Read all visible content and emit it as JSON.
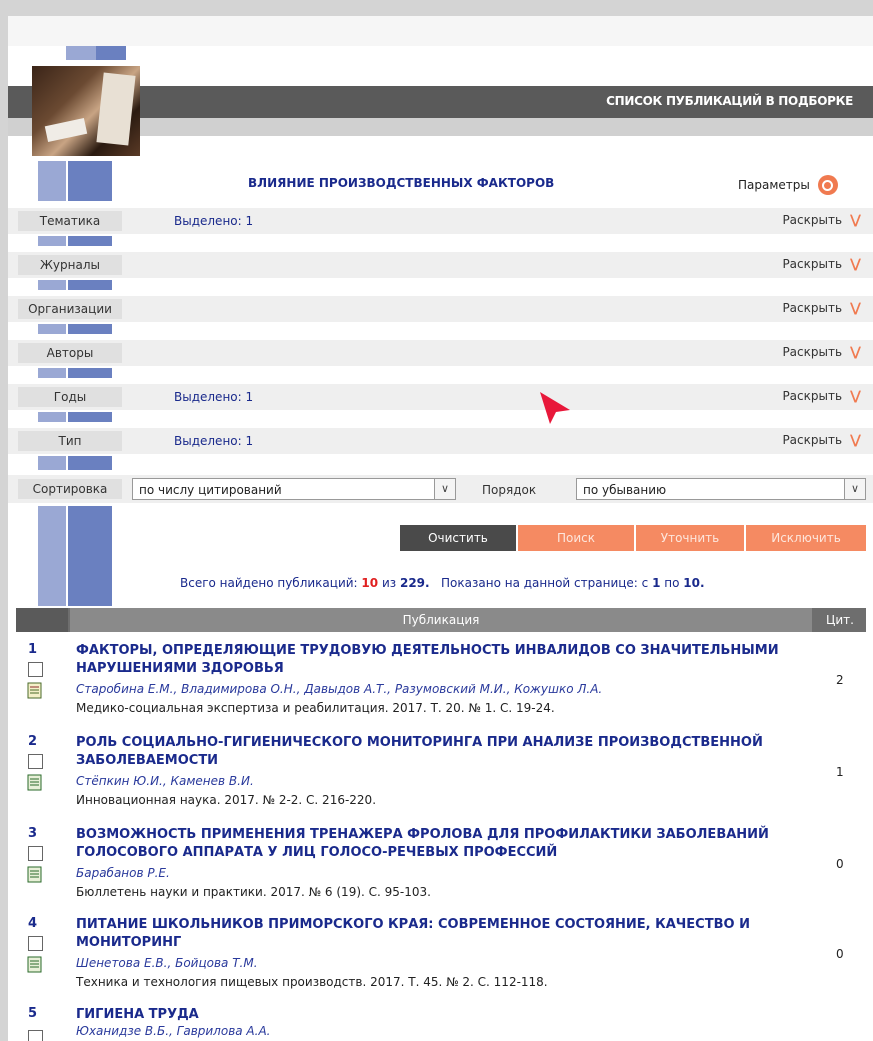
{
  "header": {
    "title": "СПИСОК ПУБЛИКАЦИЙ В ПОДБОРКЕ"
  },
  "query": {
    "title": "ВЛИЯНИЕ ПРОИЗВОДСТВЕННЫХ ФАКТОРОВ",
    "params_label": "Параметры"
  },
  "facets": [
    {
      "label": "Тематика",
      "selected": "Выделено: 1",
      "expand": "Раскрыть"
    },
    {
      "label": "Журналы",
      "selected": "",
      "expand": "Раскрыть"
    },
    {
      "label": "Организации",
      "selected": "",
      "expand": "Раскрыть"
    },
    {
      "label": "Авторы",
      "selected": "",
      "expand": "Раскрыть"
    },
    {
      "label": "Годы",
      "selected": "Выделено: 1",
      "expand": "Раскрыть"
    },
    {
      "label": "Тип",
      "selected": "Выделено: 1",
      "expand": "Раскрыть"
    }
  ],
  "sort": {
    "label": "Сортировка",
    "value": "по числу цитирований",
    "order_label": "Порядок",
    "order_value": "по убыванию"
  },
  "buttons": {
    "clear": "Очистить",
    "search": "Поиск",
    "refine": "Уточнить",
    "exclude": "Исключить"
  },
  "summary": {
    "found_prefix": "Всего найдено публикаций:",
    "found_count": "10",
    "of_text": "из",
    "total": "229.",
    "shown_prefix": "Показано на данной странице: с",
    "shown_from": "1",
    "shown_to_text": "по",
    "shown_to": "10."
  },
  "table": {
    "col_publication": "Публикация",
    "col_citations": "Цит."
  },
  "publications": [
    {
      "num": "1",
      "title": "ФАКТОРЫ, ОПРЕДЕЛЯЮЩИЕ ТРУДОВУЮ ДЕЯТЕЛЬНОСТЬ ИНВАЛИДОВ СО ЗНАЧИТЕЛЬНЫМИ НАРУШЕНИЯМИ ЗДОРОВЬЯ",
      "authors": "Старобина Е.М., Владимирова О.Н., Давыдов А.Т., Разумовский М.И., Кожушко Л.А.",
      "source": "Медико-социальная экспертиза и реабилитация. 2017. Т. 20. № 1. С. 19-24.",
      "citations": "2"
    },
    {
      "num": "2",
      "title": "РОЛЬ СОЦИАЛЬНО-ГИГИЕНИЧЕСКОГО МОНИТОРИНГА ПРИ АНАЛИЗЕ ПРОИЗВОДСТВЕННОЙ ЗАБОЛЕВАЕМОСТИ",
      "authors": "Стёпкин Ю.И., Каменев В.И.",
      "source": "Инновационная наука. 2017. № 2-2. С. 216-220.",
      "citations": "1"
    },
    {
      "num": "3",
      "title": "ВОЗМОЖНОСТЬ ПРИМЕНЕНИЯ ТРЕНАЖЕРА ФРОЛОВА ДЛЯ ПРОФИЛАКТИКИ ЗАБОЛЕВАНИЙ ГОЛОСОВОГО АППАРАТА У ЛИЦ ГОЛОСО-РЕЧЕВЫХ ПРОФЕССИЙ",
      "authors": "Барабанов Р.Е.",
      "source": "Бюллетень науки и практики. 2017. № 6 (19). С. 95-103.",
      "citations": "0"
    },
    {
      "num": "4",
      "title": "ПИТАНИЕ ШКОЛЬНИКОВ ПРИМОРСКОГО КРАЯ: СОВРЕМЕННОЕ СОСТОЯНИЕ, КАЧЕСТВО И МОНИТОРИНГ",
      "authors": "Шенетова Е.В., Бойцова Т.М.",
      "source": "Техника и технология пищевых производств. 2017. Т. 45. № 2. С. 112-118.",
      "citations": "0"
    },
    {
      "num": "5",
      "title": "ГИГИЕНА ТРУДА",
      "authors": "Юханидзе В.Б., Гаврилова А.А.",
      "source": "",
      "citations": ""
    }
  ],
  "colors": {
    "accent_orange": "#f07a50",
    "link_blue": "#1a2a8c",
    "header_gray": "#5a5a5a",
    "count_red": "#e02020"
  }
}
